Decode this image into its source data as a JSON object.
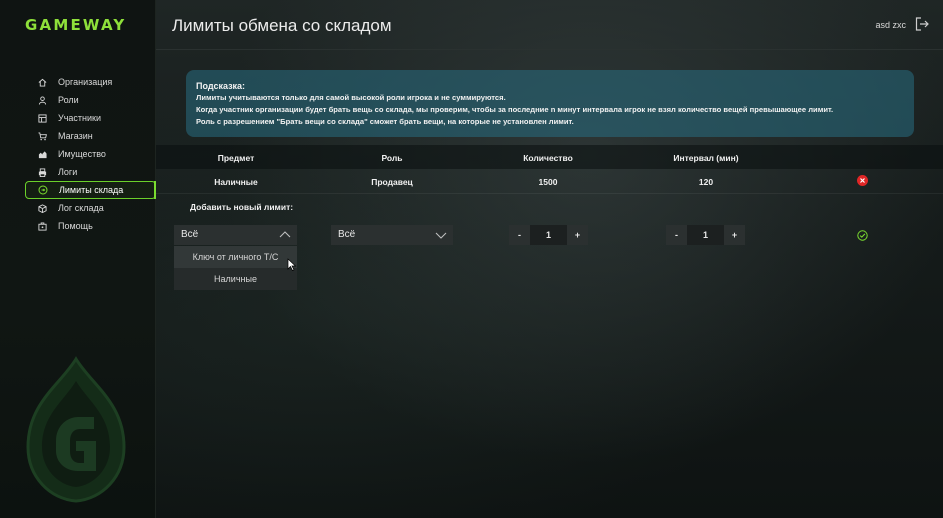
{
  "app": {
    "logo": "GAMEWAY"
  },
  "sidebar": {
    "items": [
      {
        "label": "Организация",
        "icon": "home-icon"
      },
      {
        "label": "Роли",
        "icon": "user-icon"
      },
      {
        "label": "Участники",
        "icon": "members-icon"
      },
      {
        "label": "Магазин",
        "icon": "cart-icon"
      },
      {
        "label": "Имущество",
        "icon": "property-icon"
      },
      {
        "label": "Логи",
        "icon": "printer-icon"
      },
      {
        "label": "Лимиты склада",
        "icon": "limits-icon",
        "active": true
      },
      {
        "label": "Лог склада",
        "icon": "box-icon"
      },
      {
        "label": "Помощь",
        "icon": "help-icon"
      }
    ]
  },
  "header": {
    "title": "Лимиты обмена со складом",
    "user": "asd zxc"
  },
  "hint": {
    "title": "Подсказка:",
    "lines": [
      "Лимиты учитываются только для самой высокой роли игрока и не суммируются.",
      "Когда участник организации будет брать вещь со склада, мы проверим, чтобы за последние n минут интервала игрок не взял количество вещей превышающее лимит.",
      "Роль с разрешением \"Брать вещи со склада\" сможет брать вещи, на которые не установлен лимит."
    ]
  },
  "table": {
    "columns": [
      "Предмет",
      "Роль",
      "Количество",
      "Интервал (мин)"
    ],
    "rows": [
      {
        "item": "Наличные",
        "role": "Продавец",
        "amount": "1500",
        "interval": "120"
      }
    ]
  },
  "add_form": {
    "label": "Добавить новый лимит:",
    "item_select": {
      "value": "Всё",
      "options": [
        "Ключ от личного Т/С",
        "Наличные"
      ]
    },
    "role_select": {
      "value": "Всё"
    },
    "amount": {
      "minus": "-",
      "value": "1",
      "plus": "+"
    },
    "interval": {
      "minus": "-",
      "value": "1",
      "plus": "+"
    }
  },
  "colors": {
    "accent": "#7bdd30",
    "danger": "#e02626",
    "hint_bg": "#2b6e82"
  }
}
